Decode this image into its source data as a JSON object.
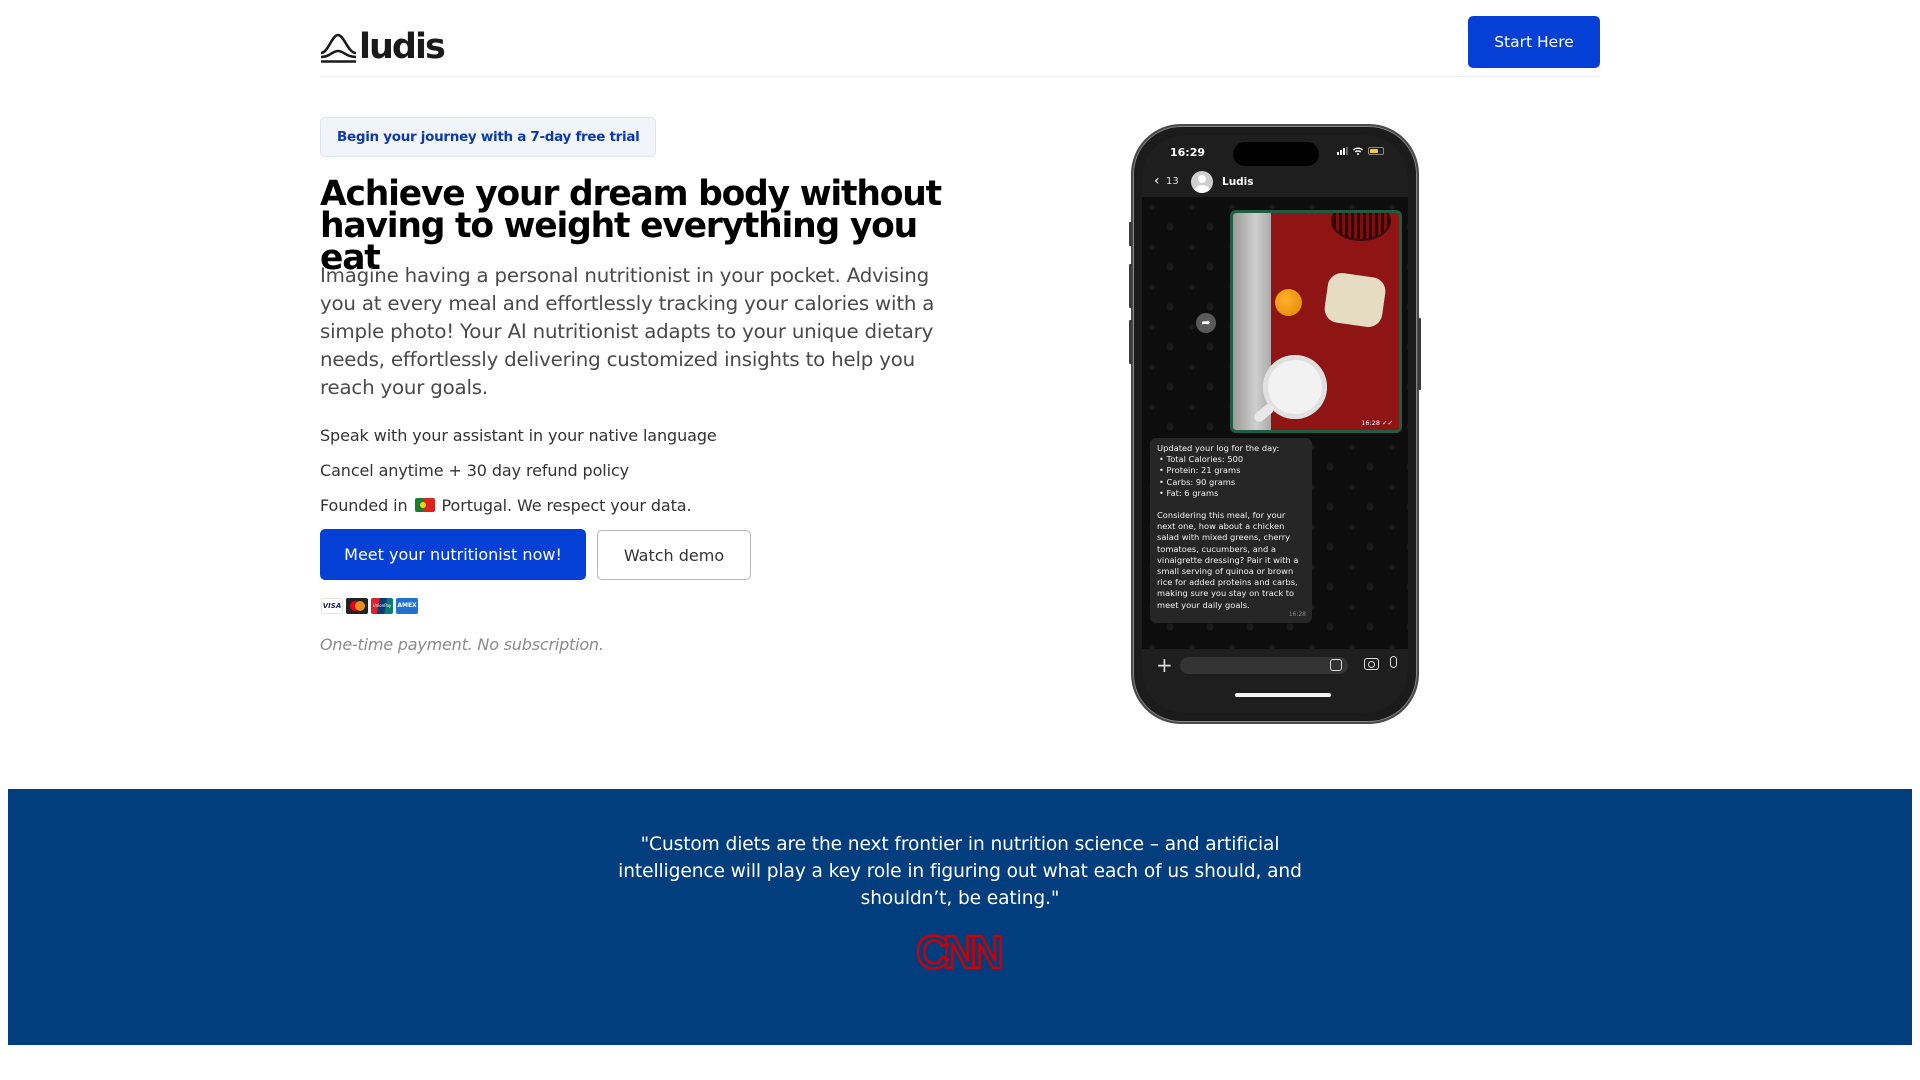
{
  "nav": {
    "logo_text": "ludis",
    "logo_icon": "wave-mountain-icon",
    "cta_label": "Start Here"
  },
  "hero": {
    "badge": "Begin your journey with a 7-day free trial",
    "headline": "Achieve your dream body without having to weight everything you eat",
    "lead": "Imagine having a personal nutritionist in your pocket. Advising you at every meal and effortlessly tracking your calories with a simple photo! Your AI nutritionist adapts to your unique dietary needs, effortlessly delivering customized insights to help you reach your goals.",
    "features": [
      {
        "text": "Speak with your assistant in your native language"
      },
      {
        "text": "Cancel anytime + 30 day refund policy"
      },
      {
        "text_before": "Founded in",
        "flag": "portugal-flag-icon",
        "text_after": "Portugal. We respect your data."
      }
    ],
    "primary_cta": "Meet your nutritionist now!",
    "secondary_cta": "Watch demo",
    "payment_methods": [
      {
        "name": "visa-icon",
        "label": "VISA"
      },
      {
        "name": "mastercard-icon",
        "label": ""
      },
      {
        "name": "unionpay-icon",
        "label": "UnionPay"
      },
      {
        "name": "amex-icon",
        "label": "AMEX"
      }
    ],
    "payment_note": "One-time payment. No subscription."
  },
  "phone": {
    "status_time": "16:29",
    "back_count": "13",
    "contact_name": "Ludis",
    "photo_timestamp": "16:28",
    "message": {
      "intro": "Updated your log for the day:",
      "items": [
        "Total Calories: 500",
        "Protein: 21 grams",
        "Carbs: 90 grams",
        "Fat: 6 grams"
      ],
      "advice": "Considering this meal, for your next one, how about a chicken salad with mixed greens, cherry tomatoes, cucumbers, and a vinaigrette dressing? Pair it with a small serving of quinoa or brown rice for added proteins and carbs, making sure you stay on track to meet your daily goals.",
      "timestamp": "16:28"
    }
  },
  "testimonial": {
    "quote": "\"Custom diets are the next frontier in nutrition science – and artificial intelligence will play a key role in figuring out what each of us should, and shouldn’t, be eating.\"",
    "source": "CNN"
  },
  "colors": {
    "brand_blue": "#0540d6",
    "banner_navy": "#023e7d",
    "cnn_red": "#cc0000",
    "badge_text": "#0d3aa8"
  }
}
